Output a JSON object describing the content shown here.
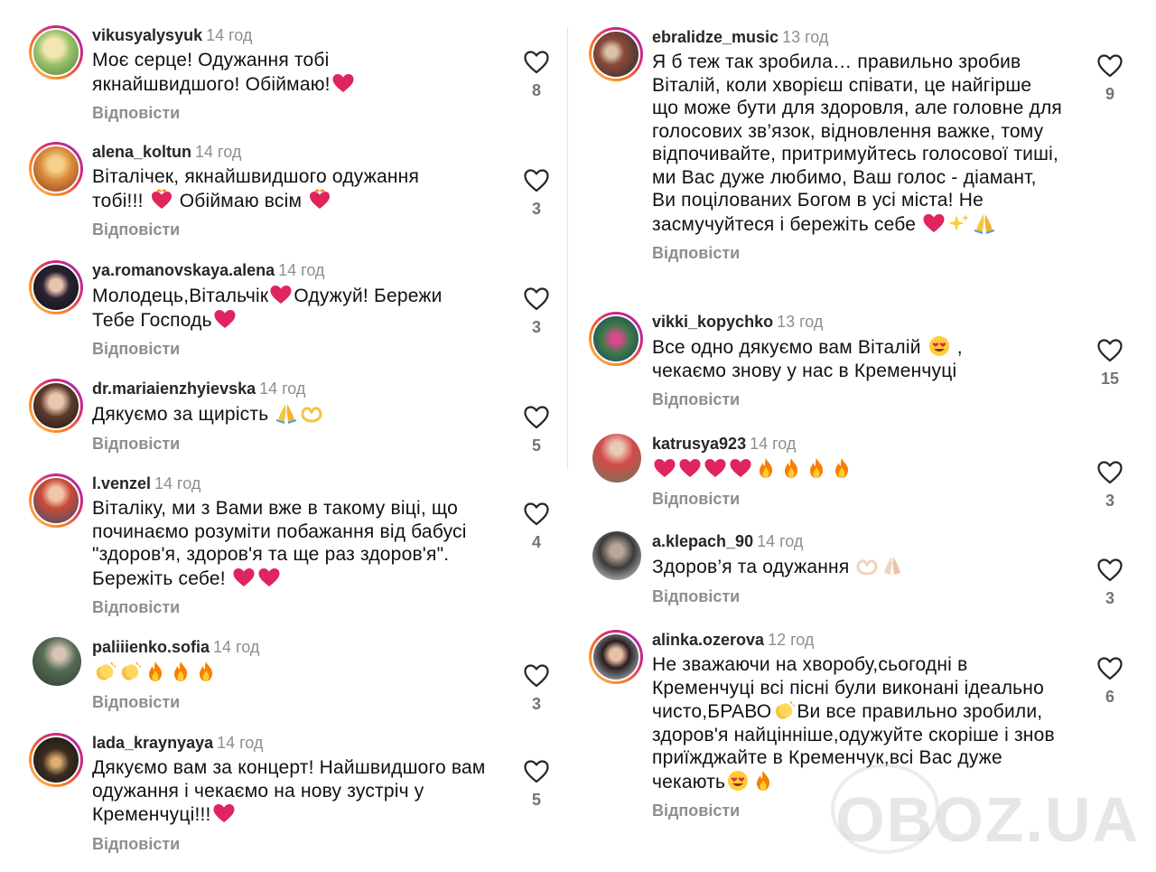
{
  "reply_label": "Відповісти",
  "comments_left": [
    {
      "user": "vikusyalysyuk",
      "time": "14 год",
      "text": "Моє серце! Одужання тобі якнайшвидшого! Обіймаю!",
      "emoji": [
        "heart"
      ],
      "likes": "8"
    },
    {
      "user": "alena_koltun",
      "time": "14 год",
      "text": "Віталічек, якнайшвидшого одужання тобі!!! ",
      "text2": " Обіймаю всім ",
      "emoji": [
        "fire-heart"
      ],
      "likes": "3"
    },
    {
      "user": "ya.romanovskaya.alena",
      "time": "14 год",
      "text": "Молодець,Вітальчік",
      "text2": "Одужуй! Бережи Тебе Господь",
      "likes": "3"
    },
    {
      "user": "dr.mariaienzhyievska",
      "time": "14 год",
      "text": "Дякуємо за щирість ",
      "likes": "5"
    },
    {
      "user": "l.venzel",
      "time": "14 год",
      "text": "Віталіку, ми з Вами вже в такому віці, що починаємо розуміти  побажання від бабусі \"здоров'я, здоров'я та ще раз здоров'я\". Бережіть себе! ",
      "likes": "4"
    },
    {
      "user": "paliiienko.sofia",
      "time": "14 год",
      "text": "",
      "likes": "3"
    },
    {
      "user": "lada_kraynyaya",
      "time": "14 год",
      "text": "Дякуємо вам за концерт! Найшвидшого вам одужання і чекаємо на нову зустріч у Кременчуці!!!",
      "likes": "5"
    }
  ],
  "comments_right": [
    {
      "user": "ebralidze_music",
      "time": "13 год",
      "text": "Я б теж так зробила… правильно зробив Віталій, коли хворієш співати, це найгірше що може бути для здоровля, але головне для голосових зв’язок, відновлення важке, тому відпочивайте, притримуйтесь голосової тиші, ми Вас дуже любимо, Ваш голос - діамант, Ви поцілованих Богом в усі міста! Не засмучуйтеся і бережіть себе ",
      "likes": "9"
    },
    {
      "user": "vikki_kopychko",
      "time": "13 год",
      "text": "Все одно дякуємо вам Віталій ",
      "text2": " , чекаємо знову у нас в Кременчуці",
      "likes": "15"
    },
    {
      "user": "katrusya923",
      "time": "14 год",
      "text": "",
      "likes": "3"
    },
    {
      "user": "a.klepach_90",
      "time": "14 год",
      "text": "Здоров’я та одужання ",
      "likes": "3"
    },
    {
      "user": "alinka.ozerova",
      "time": "12 год",
      "text": "Не зважаючи на хворобу,сьогодні в Кременчуці всі пісні були виконані ідеально чисто,БРАВО",
      "text2": "Ви все правильно зробили, здоров'я найцінніше,одужуйте скоріше і знов приїжджайте в Кременчук,всі Вас дуже чекають",
      "likes": "6"
    }
  ],
  "watermark": "OBOZ.UA",
  "colors": {
    "heart": "#e0245e",
    "fire": "#f77f00",
    "ring_start": "#fdc468",
    "ring_end": "#962fbf",
    "muted": "#8e8e8e"
  },
  "icons": {
    "like": "heart-outline-icon",
    "reactions": [
      "heart-icon",
      "fire-icon",
      "fire-heart-icon",
      "clap-icon",
      "pray-icon",
      "heart-hands-icon",
      "heart-eyes-icon",
      "sparkles-icon"
    ]
  }
}
